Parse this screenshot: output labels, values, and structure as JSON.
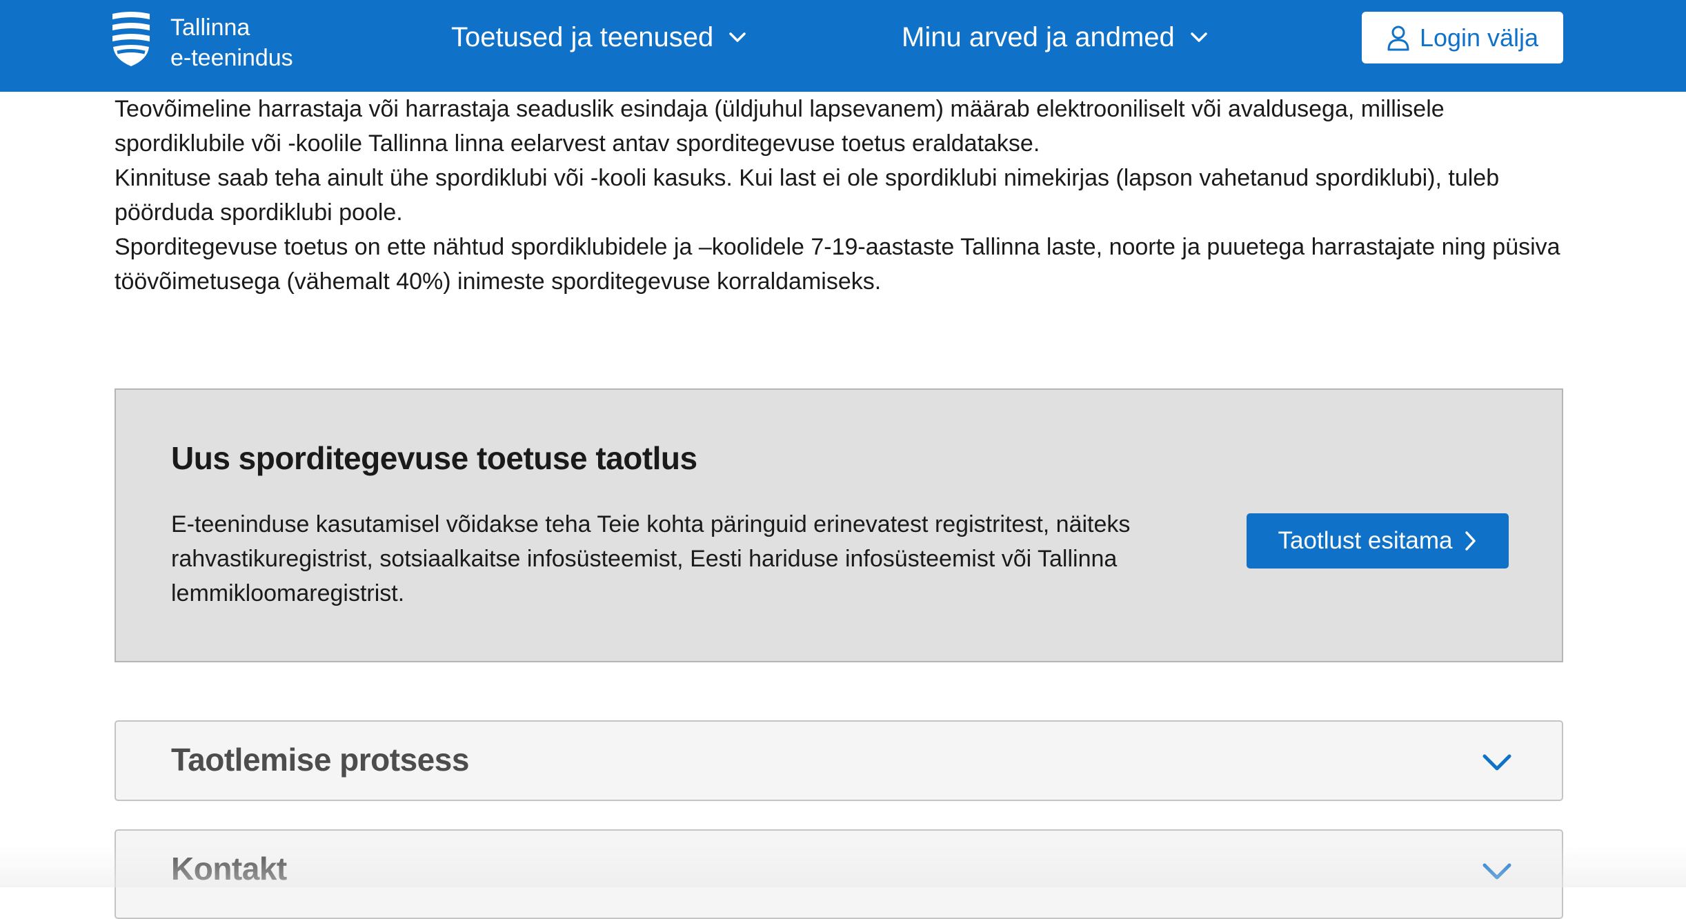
{
  "header": {
    "brand_line1": "Tallinna",
    "brand_line2": "e-teenindus",
    "nav": [
      {
        "label": "Toetused ja teenused",
        "icon": "chevron-down-icon"
      },
      {
        "label": "Minu arved ja andmed",
        "icon": "chevron-down-icon"
      }
    ],
    "login_label": "Login välja",
    "login_icon": "user-icon",
    "logo_icon": "tallinn-shield-icon"
  },
  "intro": {
    "paragraphs": [
      "Teovõimeline harrastaja või harrastaja seaduslik esindaja (üldjuhul lapsevanem) määrab elektrooniliselt või avaldusega, millisele spordiklubile või -koolile Tallinna linna eelarvest antav sporditegevuse toetus eraldatakse.",
      "Kinnituse saab teha ainult ühe spordiklubi või -kooli kasuks. Kui last ei ole spordiklubi nimekirjas (lapson vahetanud spordiklubi), tuleb pöörduda spordiklubi poole.",
      "Sporditegevuse toetus on ette nähtud spordiklubidele ja –koolidele 7-19-aastaste Tallinna laste, noorte ja puuetega harrastajate ning püsiva töövõimetusega (vähemalt 40%) inimeste sporditegevuse korraldamiseks."
    ]
  },
  "cta": {
    "title": "Uus sporditegevuse toetuse taotlus",
    "text": "E-teeninduse kasutamisel võidakse teha Teie kohta päringuid erinevatest registritest, näiteks rahvastikuregistrist, sotsiaalkaitse infosüsteemist, Eesti hariduse infosüsteemist või Tallinna lemmikloomaregistrist.",
    "button_label": "Taotlust esitama",
    "button_icon": "chevron-right-icon"
  },
  "accordions": [
    {
      "title": "Taotlemise protsess",
      "icon": "chevron-down-icon"
    },
    {
      "title": "Kontakt",
      "icon": "chevron-down-icon"
    }
  ],
  "colors": {
    "primary": "#0f72c8",
    "cta_background": "#e0e0e0",
    "accordion_title": "#4d4d4d"
  }
}
